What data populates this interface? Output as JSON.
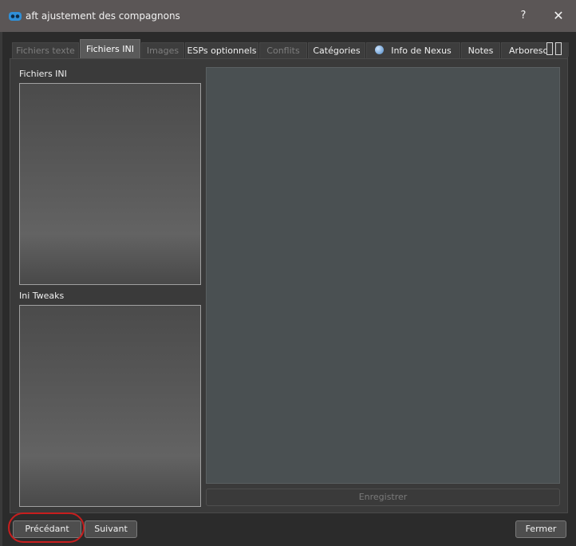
{
  "window": {
    "title": "aft ajustement des compagnons",
    "help_label": "?",
    "close_label": "✕"
  },
  "tabs": [
    {
      "label": "Fichiers texte",
      "state": "disabled"
    },
    {
      "label": "Fichiers INI",
      "state": "active"
    },
    {
      "label": "Images",
      "state": "disabled"
    },
    {
      "label": "ESPs optionnels",
      "state": "normal"
    },
    {
      "label": "Conflits",
      "state": "disabled"
    },
    {
      "label": "Catégories",
      "state": "normal"
    },
    {
      "label": "Info de Nexus",
      "state": "normal",
      "icon": "globe-icon"
    },
    {
      "label": "Notes",
      "state": "normal"
    },
    {
      "label": "Arboresc...",
      "state": "normal"
    }
  ],
  "ini": {
    "files_label": "Fichiers INI",
    "tweaks_label": "Ini Tweaks",
    "save_label": "Enregistrer"
  },
  "footer": {
    "previous_label": "Précédant",
    "next_label": "Suivant",
    "close_label": "Fermer"
  },
  "colors": {
    "annotation": "#c81e1e",
    "titlebar": "#5b5656",
    "background": "#2b2b2b"
  }
}
